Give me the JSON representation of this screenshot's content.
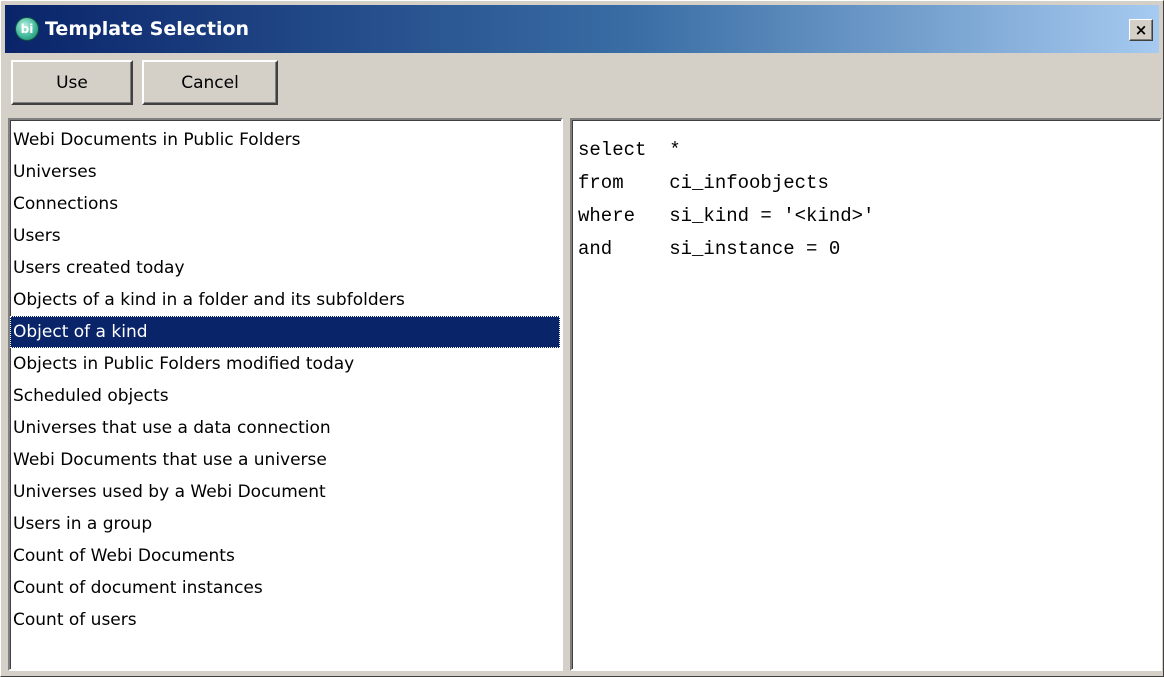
{
  "window": {
    "title": "Template Selection",
    "close_label": "×",
    "icon_label": "bi"
  },
  "toolbar": {
    "use_label": "Use",
    "cancel_label": "Cancel"
  },
  "templates": {
    "selected_index": 6,
    "items": [
      "Webi Documents in Public Folders",
      "Universes",
      "Connections",
      "Users",
      "Users created today",
      "Objects of a kind in a folder and its subfolders",
      "Object of a kind",
      "Objects in Public Folders modified today",
      "Scheduled objects",
      "Universes that use a data connection",
      "Webi Documents that use a universe",
      "Universes used by a Webi Document",
      "Users in a group",
      "Count of Webi Documents",
      "Count of document instances",
      "Count of users"
    ]
  },
  "query": {
    "lines": [
      "select  *",
      "from    ci_infoobjects",
      "where   si_kind = '<kind>'",
      "and     si_instance = 0"
    ]
  },
  "colors": {
    "title_gradient_start": "#0a246a",
    "title_gradient_end": "#a6caf0",
    "selection_background": "#0a246a",
    "dialog_face": "#d4d0c8"
  }
}
